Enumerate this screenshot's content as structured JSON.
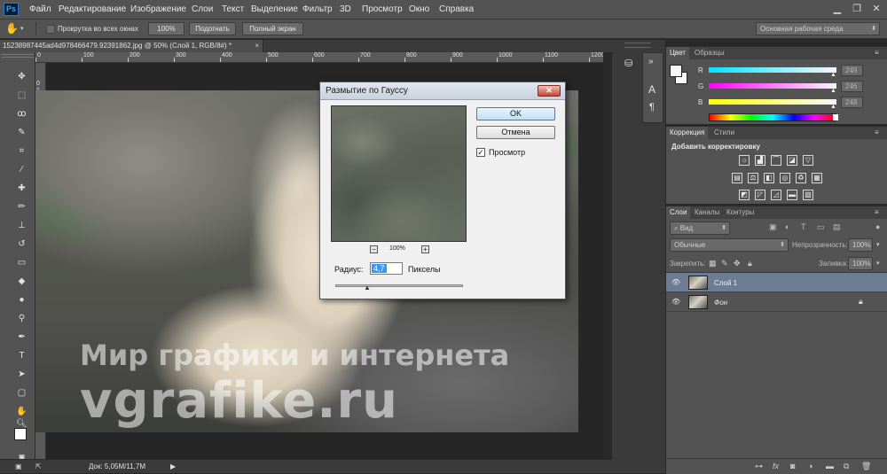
{
  "app": {
    "logo": "Ps"
  },
  "menu": [
    "Файл",
    "Редактирование",
    "Изображение",
    "Слои",
    "Текст",
    "Выделение",
    "Фильтр",
    "3D",
    "Просмотр",
    "Окно",
    "Справка"
  ],
  "window_controls": [
    "minimize-icon",
    "restore-icon",
    "close-icon"
  ],
  "options_bar": {
    "scroll_all_label": "Прокрутка во всех окнах",
    "btn_100": "100%",
    "btn_fit": "Подогнать",
    "btn_fullscreen": "Полный экран",
    "workspace": "Основная рабочая среда"
  },
  "document": {
    "tab_title": "15238987445ad4d978466479.92391862.jpg @ 50% (Слой 1, RGB/8#) *",
    "status": "Док: 5,05M/11,7M"
  },
  "rulers": {
    "top": [
      "0",
      "100",
      "200",
      "300",
      "400",
      "500",
      "600",
      "700",
      "800",
      "900",
      "1000",
      "1100",
      "1200"
    ],
    "left": [
      "0",
      "1",
      "0",
      "0",
      "1",
      "5",
      "0",
      "2",
      "0",
      "0",
      "2",
      "5",
      "0",
      "3",
      "0",
      "0",
      "3",
      "5",
      "0"
    ]
  },
  "watermark": {
    "line1": "Мир графики и интернета",
    "line2": "vgrafike.ru"
  },
  "dialog": {
    "title": "Размытие по Гауссу",
    "ok": "OK",
    "cancel": "Отмена",
    "preview_label": "Просмотр",
    "preview_checked": true,
    "zoom": "100%",
    "radius_label": "Радиус:",
    "radius_value": "4,7",
    "units": "Пикселы"
  },
  "color_panel": {
    "tabs": [
      "Цвет",
      "Образцы"
    ],
    "channels": [
      {
        "label": "R",
        "value": "249",
        "color": "#00e5ff"
      },
      {
        "label": "G",
        "value": "246",
        "color": "#ff00ff"
      },
      {
        "label": "B",
        "value": "248",
        "color": "#ffff00"
      }
    ]
  },
  "adjustments_panel": {
    "tabs": [
      "Коррекция",
      "Стили"
    ],
    "title": "Добавить корректировку"
  },
  "layers_panel": {
    "tabs": [
      "Слои",
      "Каналы",
      "Контуры"
    ],
    "filter": "Вид",
    "blend_mode": "Обычные",
    "opacity_label": "Непрозрачность:",
    "opacity_value": "100%",
    "lock_label": "Закрепить:",
    "fill_label": "Заливка:",
    "fill_value": "100%",
    "layers": [
      {
        "name": "Слой 1",
        "selected": true,
        "locked": false
      },
      {
        "name": "Фон",
        "selected": false,
        "locked": true
      }
    ]
  },
  "colors": {
    "accent_selection": "#6b7c93",
    "ps_blue": "#33a1fd"
  }
}
